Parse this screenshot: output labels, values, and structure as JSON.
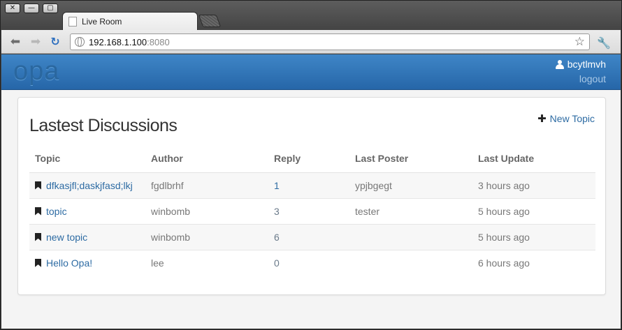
{
  "browser": {
    "window_controls": {
      "close": "✕",
      "minimize": "—",
      "maximize": "▢"
    },
    "tab_title": "Live Room",
    "url_host": "192.168.1.100",
    "url_port": ":8080"
  },
  "navbar": {
    "logo": "opa",
    "username": "bcytlmvh",
    "logout": "logout"
  },
  "main": {
    "title": "Lastest Discussions",
    "new_topic": "New Topic",
    "columns": [
      "Topic",
      "Author",
      "Reply",
      "Last Poster",
      "Last Update"
    ],
    "rows": [
      {
        "topic": "dfkasjfl;daskjfasd;lkj",
        "author": "fgdlbrhf",
        "reply": "1",
        "last_poster": "ypjbgegt",
        "last_update": "3 hours ago"
      },
      {
        "topic": "topic",
        "author": "winbomb",
        "reply": "3",
        "last_poster": "tester",
        "last_update": "5 hours ago"
      },
      {
        "topic": "new topic",
        "author": "winbomb",
        "reply": "6",
        "last_poster": "",
        "last_update": "5 hours ago"
      },
      {
        "topic": "Hello Opa!",
        "author": "lee",
        "reply": "0",
        "last_poster": "",
        "last_update": "6 hours ago"
      }
    ]
  },
  "colors": {
    "navbar": "#2f74b7",
    "link": "#2d6ba3"
  },
  "icons": [
    "back-arrow-icon",
    "forward-arrow-icon",
    "reload-icon",
    "globe-icon",
    "star-icon",
    "wrench-icon",
    "user-icon",
    "plus-icon",
    "bookmark-icon"
  ]
}
